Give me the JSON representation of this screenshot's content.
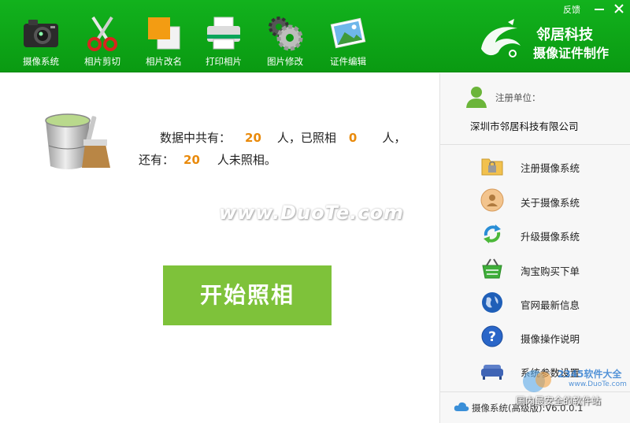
{
  "toolbar": {
    "items": [
      {
        "label": "摄像系统",
        "icon": "camera-icon"
      },
      {
        "label": "相片剪切",
        "icon": "scissors-icon"
      },
      {
        "label": "相片改名",
        "icon": "rename-icon"
      },
      {
        "label": "打印相片",
        "icon": "printer-icon"
      },
      {
        "label": "图片修改",
        "icon": "gears-icon"
      },
      {
        "label": "证件编辑",
        "icon": "picture-icon"
      }
    ],
    "feedback_label": "反馈",
    "minimize_label": "—",
    "close_label": "✕"
  },
  "brand": {
    "line1": "邻居科技",
    "line2": "摄像证件制作"
  },
  "main": {
    "info": {
      "part1": "数据中共有：",
      "total": "20",
      "part2": "人，已照相",
      "taken": "0",
      "part3": "人，",
      "part4": "还有：",
      "remaining": "20",
      "part5": "人未照相。"
    },
    "watermark": "www.DuoTe.com",
    "start_button": "开始照相"
  },
  "sidebar": {
    "register_label": "注册单位：",
    "company": "深圳市邻居科技有限公司",
    "items": [
      {
        "label": "注册摄像系统",
        "icon": "folder-lock-icon"
      },
      {
        "label": "关于摄像系统",
        "icon": "user-info-icon"
      },
      {
        "label": "升级摄像系统",
        "icon": "refresh-icon"
      },
      {
        "label": "淘宝购买下单",
        "icon": "shopping-basket-icon"
      },
      {
        "label": "官网最新信息",
        "icon": "globe-icon"
      },
      {
        "label": "摄像操作说明",
        "icon": "help-icon"
      },
      {
        "label": "系统参数设置",
        "icon": "sofa-settings-icon"
      }
    ],
    "version": "摄像系统(高级版):V6.0.0.1",
    "corner_text": "国内最安全的软件站",
    "corner_logo_text": "2345软件大全",
    "corner_logo_url": "www.DuoTe.com"
  },
  "colors": {
    "topbar": "#0a9a12",
    "start_button": "#7ec23a",
    "number": "#e98a0b"
  }
}
